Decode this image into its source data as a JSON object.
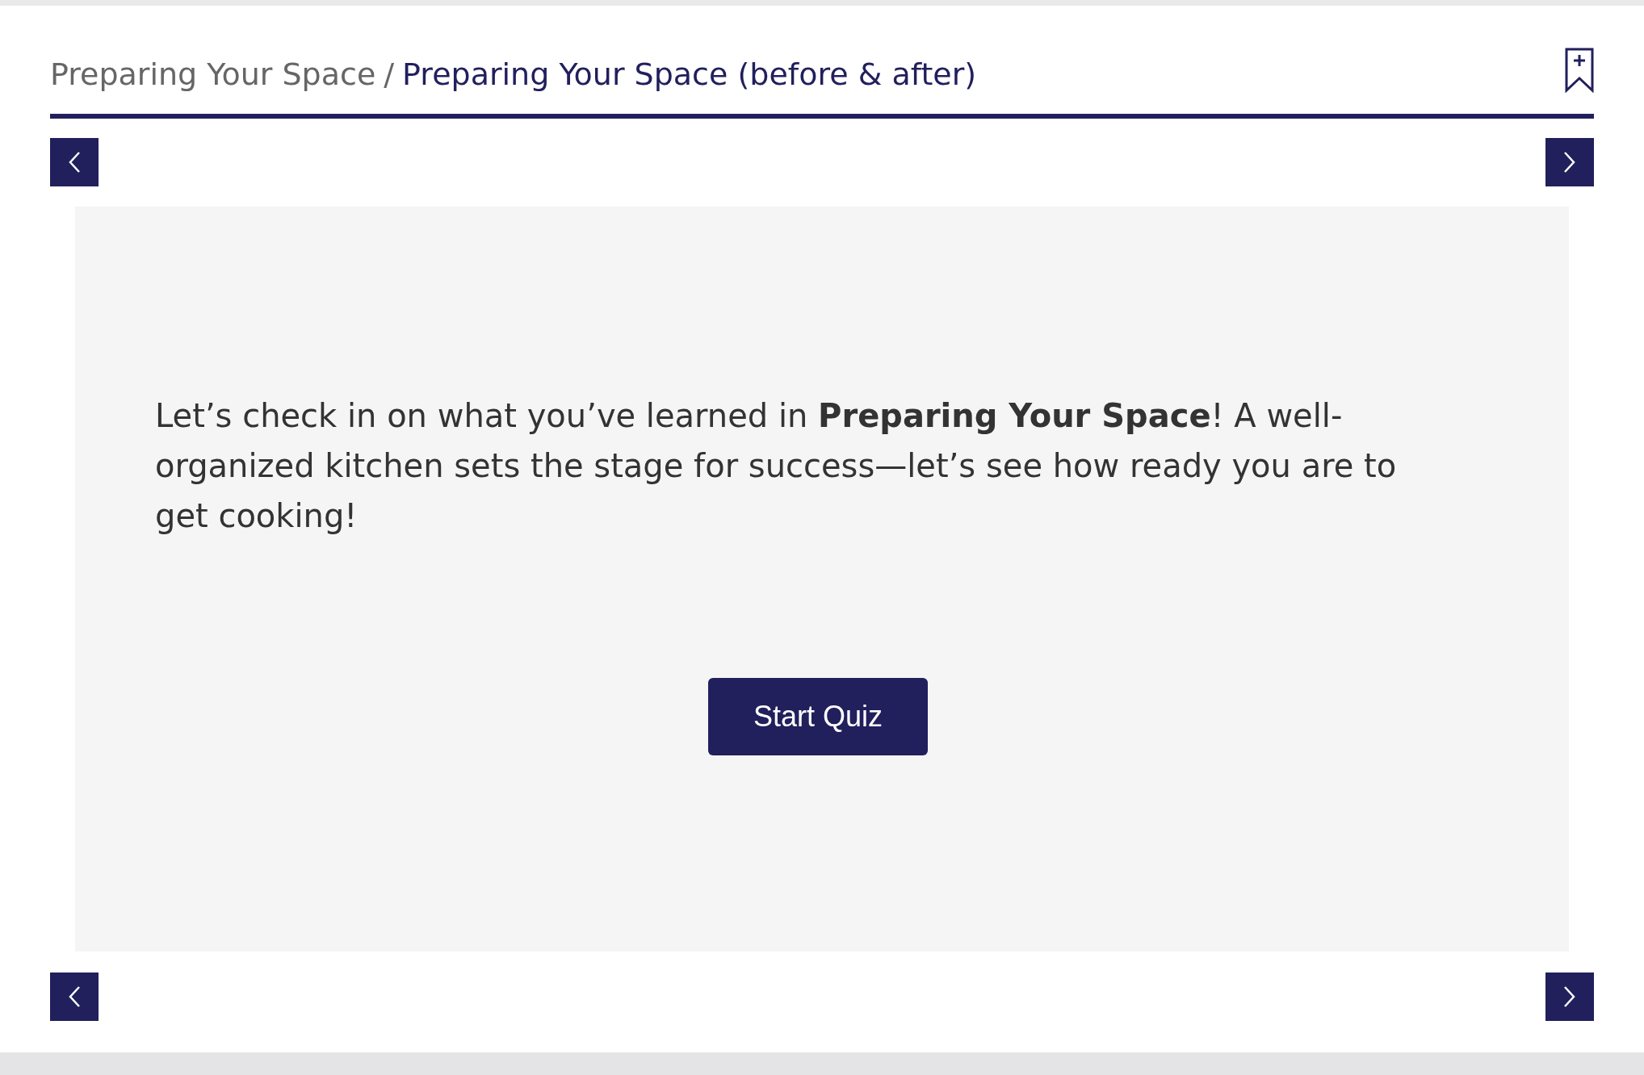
{
  "breadcrumb": {
    "parent": "Preparing Your Space",
    "separator": "/",
    "current": "Preparing Your Space (before & after)"
  },
  "message": "Let’s check in on what you’ve learned in **Preparing Your Space**! A well-organized kitchen sets the stage for success—let’s see how ready you are to get cooking!",
  "start_button": "Start Quiz"
}
